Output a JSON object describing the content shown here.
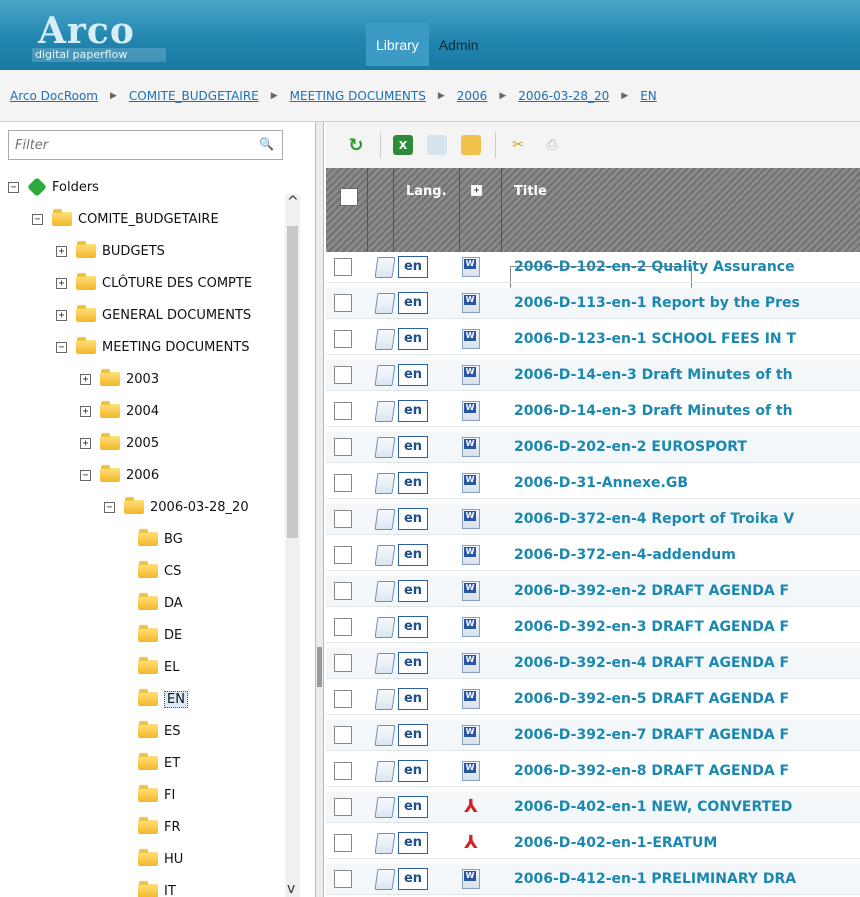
{
  "header": {
    "logo_word": "Arco",
    "logo_tagline": "digital paperflow",
    "tabs": [
      "Library",
      "Admin"
    ]
  },
  "breadcrumb": [
    "Arco DocRoom",
    "COMITE_BUDGETAIRE",
    "MEETING DOCUMENTS",
    "2006",
    "2006-03-28_20",
    "EN"
  ],
  "tree": {
    "filter_placeholder": "Filter",
    "root": "Folders",
    "nodes": {
      "comite": "COMITE_BUDGETAIRE",
      "budgets": "BUDGETS",
      "cloture": "CLÔTURE DES COMPTE",
      "general": "GENERAL DOCUMENTS",
      "meeting": "MEETING DOCUMENTS",
      "y2003": "2003",
      "y2004": "2004",
      "y2005": "2005",
      "y2006": "2006",
      "session": "2006-03-28_20"
    },
    "languages": [
      "BG",
      "CS",
      "DA",
      "DE",
      "EL",
      "EN",
      "ES",
      "ET",
      "FI",
      "FR",
      "HU",
      "IT"
    ],
    "selected": "EN"
  },
  "table": {
    "col_lang": "Lang.",
    "col_title": "Title",
    "rows": [
      {
        "lang": "en",
        "type": "word",
        "title": "2006-D-102-en-2 Quality Assurance"
      },
      {
        "lang": "en",
        "type": "word",
        "title": "2006-D-113-en-1 Report by the Pres"
      },
      {
        "lang": "en",
        "type": "word",
        "title": "2006-D-123-en-1 SCHOOL FEES IN T"
      },
      {
        "lang": "en",
        "type": "word",
        "title": "2006-D-14-en-3 Draft Minutes of th"
      },
      {
        "lang": "en",
        "type": "word",
        "title": "2006-D-14-en-3 Draft Minutes of th"
      },
      {
        "lang": "en",
        "type": "word",
        "title": "2006-D-202-en-2 EUROSPORT"
      },
      {
        "lang": "en",
        "type": "word",
        "title": "2006-D-31-Annexe.GB"
      },
      {
        "lang": "en",
        "type": "word",
        "title": "2006-D-372-en-4 Report of Troika V"
      },
      {
        "lang": "en",
        "type": "word",
        "title": "2006-D-372-en-4-addendum"
      },
      {
        "lang": "en",
        "type": "word",
        "title": "2006-D-392-en-2 DRAFT AGENDA F"
      },
      {
        "lang": "en",
        "type": "word",
        "title": "2006-D-392-en-3 DRAFT AGENDA F"
      },
      {
        "lang": "en",
        "type": "word",
        "title": "2006-D-392-en-4 DRAFT AGENDA F"
      },
      {
        "lang": "en",
        "type": "word",
        "title": "2006-D-392-en-5 DRAFT AGENDA F"
      },
      {
        "lang": "en",
        "type": "word",
        "title": "2006-D-392-en-7 DRAFT AGENDA F"
      },
      {
        "lang": "en",
        "type": "word",
        "title": "2006-D-392-en-8 DRAFT AGENDA F"
      },
      {
        "lang": "en",
        "type": "pdf",
        "title": "2006-D-402-en-1 NEW, CONVERTED"
      },
      {
        "lang": "en",
        "type": "pdf",
        "title": "2006-D-402-en-1-ERATUM"
      },
      {
        "lang": "en",
        "type": "word",
        "title": "2006-D-412-en-1 PRELIMINARY DRA"
      }
    ]
  }
}
